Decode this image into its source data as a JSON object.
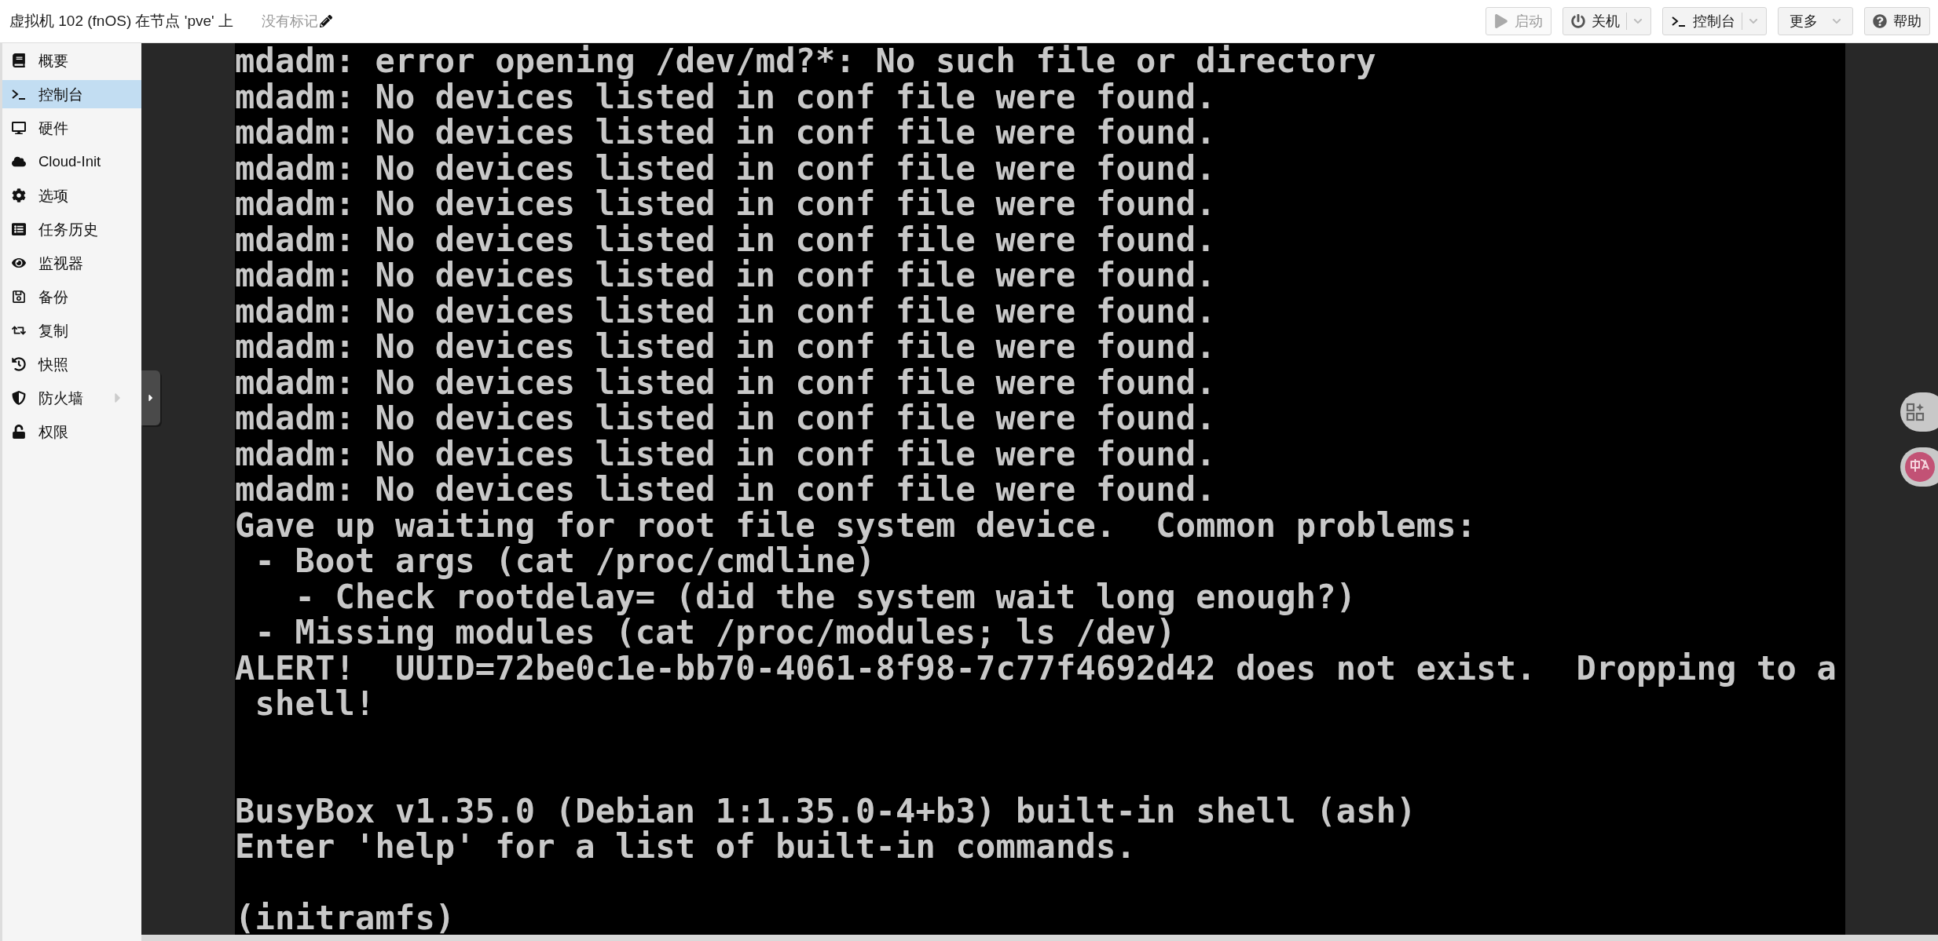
{
  "header": {
    "title": "虚拟机 102 (fnOS) 在节点 'pve' 上",
    "tags": "没有标记"
  },
  "toolbar": [
    {
      "label": "启动",
      "kind": "button",
      "disabled": true
    },
    {
      "label": "关机",
      "kind": "split",
      "disabled": false
    },
    {
      "label": "控制台",
      "kind": "split",
      "disabled": false
    },
    {
      "label": "更多",
      "kind": "menu",
      "disabled": false
    },
    {
      "label": "帮助",
      "kind": "button",
      "disabled": false
    }
  ],
  "sidebar": {
    "items": [
      {
        "label": "概要",
        "selected": false
      },
      {
        "label": "控制台",
        "selected": true
      },
      {
        "label": "硬件",
        "selected": false
      },
      {
        "label": "Cloud-Init",
        "selected": false
      },
      {
        "label": "选项",
        "selected": false
      },
      {
        "label": "任务历史",
        "selected": false
      },
      {
        "label": "监视器",
        "selected": false
      },
      {
        "label": "备份",
        "selected": false
      },
      {
        "label": "复制",
        "selected": false
      },
      {
        "label": "快照",
        "selected": false
      },
      {
        "label": "防火墙",
        "selected": false,
        "expanded": false
      },
      {
        "label": "权限",
        "selected": false
      }
    ]
  },
  "console": {
    "blocks": [
      {
        "lines": [
          "mdadm: error opening /dev/md?*: No such file or directory",
          "mdadm: No devices listed in conf file were found.",
          "mdadm: No devices listed in conf file were found.",
          "mdadm: No devices listed in conf file were found.",
          "mdadm: No devices listed in conf file were found.",
          "mdadm: No devices listed in conf file were found.",
          "mdadm: No devices listed in conf file were found.",
          "mdadm: No devices listed in conf file were found.",
          "mdadm: No devices listed in conf file were found.",
          "mdadm: No devices listed in conf file were found.",
          "mdadm: No devices listed in conf file were found.",
          "mdadm: No devices listed in conf file were found.",
          "mdadm: No devices listed in conf file were found.",
          "Gave up waiting for root file system device.  Common problems:",
          " - Boot args (cat /proc/cmdline)",
          "   - Check rootdelay= (did the system wait long enough?)",
          " - Missing modules (cat /proc/modules; ls /dev)",
          "ALERT!  UUID=72be0c1e-bb70-4061-8f98-7c77f4692d42 does not exist.  Dropping to a",
          " shell!"
        ]
      },
      {
        "lines": [
          "BusyBox v1.35.0 (Debian 1:1.35.0-4+b3) built-in shell (ash)",
          "Enter 'help' for a list of built-in commands."
        ]
      },
      {
        "lines": [
          "(initramfs)"
        ]
      }
    ]
  }
}
